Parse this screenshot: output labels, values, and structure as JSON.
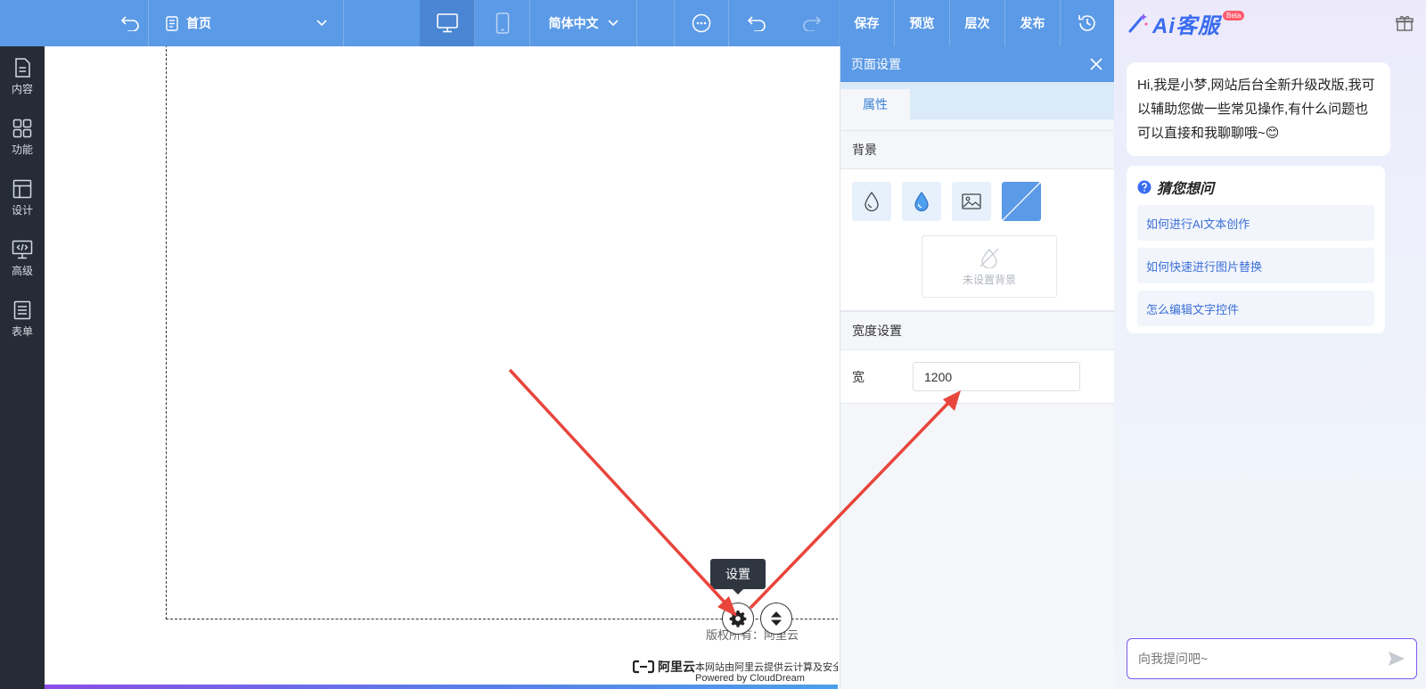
{
  "toolbar": {
    "page_select": "首页",
    "language": "简体中文",
    "save": "保存",
    "preview": "预览",
    "layers": "层次",
    "publish": "发布"
  },
  "sidebar": {
    "items": [
      {
        "label": "内容",
        "icon": "document-icon"
      },
      {
        "label": "功能",
        "icon": "grid-icon"
      },
      {
        "label": "设计",
        "icon": "layout-icon"
      },
      {
        "label": "高级",
        "icon": "code-monitor-icon"
      },
      {
        "label": "表单",
        "icon": "form-icon"
      }
    ]
  },
  "canvas": {
    "tooltip": "设置",
    "copyright": "版权所有：阿里云",
    "footer_brand": "阿里云",
    "footer_desc": "本网站由阿里云提供云计算及安全",
    "footer_powered": "Powered by CloudDream"
  },
  "settings": {
    "title": "页面设置",
    "tab_attributes": "属性",
    "section_background": "背景",
    "no_background": "未设置背景",
    "section_width": "宽度设置",
    "width_label": "宽",
    "width_value": "1200"
  },
  "ai": {
    "logo_text": "Ai客服",
    "beta": "Beta",
    "greeting": "Hi,我是小梦,网站后台全新升级改版,我可以辅助您做一些常见操作,有什么问题也可以直接和我聊聊哦~😊",
    "faq_title": "猜您想问",
    "faq": [
      "如何进行AI文本创作",
      "如何快速进行图片替换",
      "怎么编辑文字控件"
    ],
    "input_placeholder": "向我提问吧~"
  },
  "colors": {
    "toolbar": "#5b9ae6",
    "sidebar": "#252c37",
    "accent": "#3b82d6",
    "arrow": "#e8453c"
  }
}
